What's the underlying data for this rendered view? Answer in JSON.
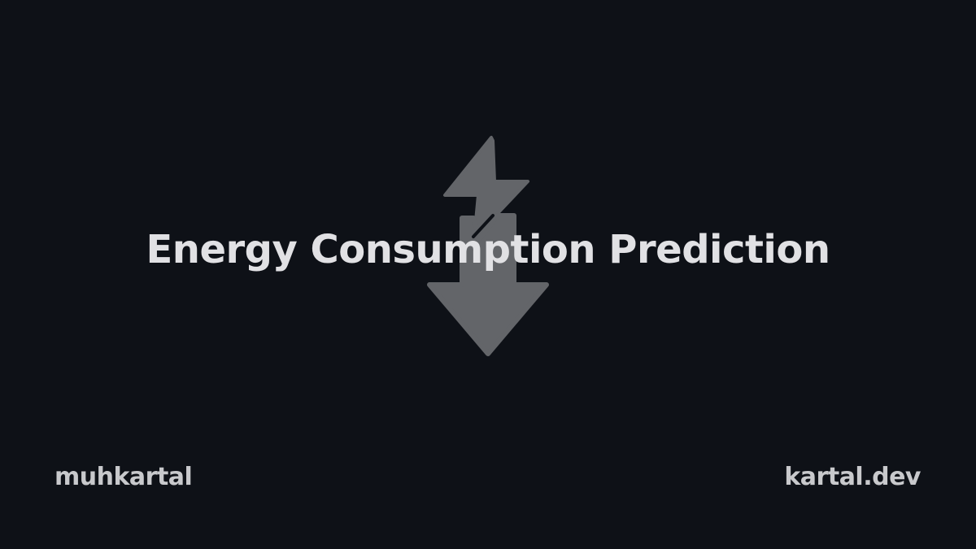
{
  "title": "Energy Consumption Prediction",
  "footer": {
    "handle": "muhkartal",
    "site": "kartal.dev"
  },
  "icon": {
    "name": "lightning-down-arrow-icon",
    "color": "#636569"
  },
  "colors": {
    "background": "#0e1117",
    "title": "#e1e1e4",
    "footer": "#c8c9cc"
  }
}
